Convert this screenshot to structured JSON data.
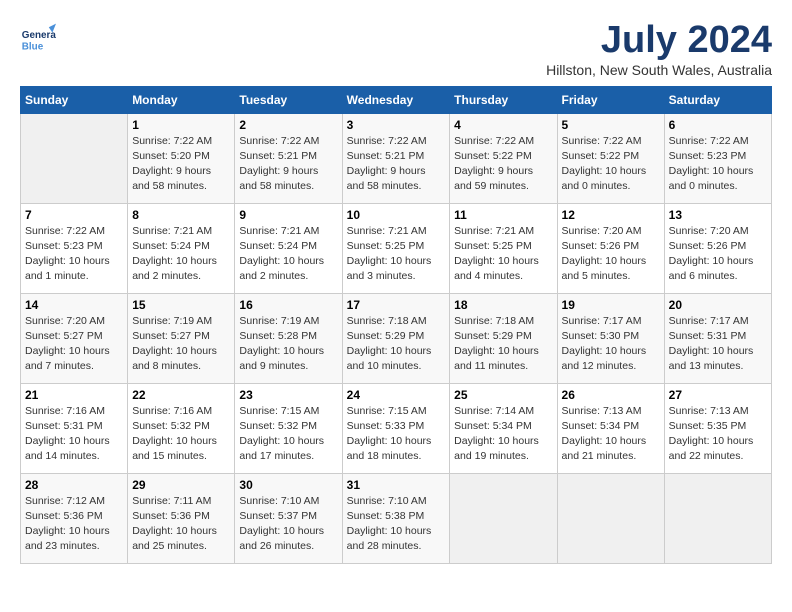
{
  "header": {
    "logo_general": "General",
    "logo_blue": "Blue",
    "month_title": "July 2024",
    "location": "Hillston, New South Wales, Australia"
  },
  "days_of_week": [
    "Sunday",
    "Monday",
    "Tuesday",
    "Wednesday",
    "Thursday",
    "Friday",
    "Saturday"
  ],
  "weeks": [
    [
      {
        "day": "",
        "info": ""
      },
      {
        "day": "1",
        "info": "Sunrise: 7:22 AM\nSunset: 5:20 PM\nDaylight: 9 hours\nand 58 minutes."
      },
      {
        "day": "2",
        "info": "Sunrise: 7:22 AM\nSunset: 5:21 PM\nDaylight: 9 hours\nand 58 minutes."
      },
      {
        "day": "3",
        "info": "Sunrise: 7:22 AM\nSunset: 5:21 PM\nDaylight: 9 hours\nand 58 minutes."
      },
      {
        "day": "4",
        "info": "Sunrise: 7:22 AM\nSunset: 5:22 PM\nDaylight: 9 hours\nand 59 minutes."
      },
      {
        "day": "5",
        "info": "Sunrise: 7:22 AM\nSunset: 5:22 PM\nDaylight: 10 hours\nand 0 minutes."
      },
      {
        "day": "6",
        "info": "Sunrise: 7:22 AM\nSunset: 5:23 PM\nDaylight: 10 hours\nand 0 minutes."
      }
    ],
    [
      {
        "day": "7",
        "info": "Sunrise: 7:22 AM\nSunset: 5:23 PM\nDaylight: 10 hours\nand 1 minute."
      },
      {
        "day": "8",
        "info": "Sunrise: 7:21 AM\nSunset: 5:24 PM\nDaylight: 10 hours\nand 2 minutes."
      },
      {
        "day": "9",
        "info": "Sunrise: 7:21 AM\nSunset: 5:24 PM\nDaylight: 10 hours\nand 2 minutes."
      },
      {
        "day": "10",
        "info": "Sunrise: 7:21 AM\nSunset: 5:25 PM\nDaylight: 10 hours\nand 3 minutes."
      },
      {
        "day": "11",
        "info": "Sunrise: 7:21 AM\nSunset: 5:25 PM\nDaylight: 10 hours\nand 4 minutes."
      },
      {
        "day": "12",
        "info": "Sunrise: 7:20 AM\nSunset: 5:26 PM\nDaylight: 10 hours\nand 5 minutes."
      },
      {
        "day": "13",
        "info": "Sunrise: 7:20 AM\nSunset: 5:26 PM\nDaylight: 10 hours\nand 6 minutes."
      }
    ],
    [
      {
        "day": "14",
        "info": "Sunrise: 7:20 AM\nSunset: 5:27 PM\nDaylight: 10 hours\nand 7 minutes."
      },
      {
        "day": "15",
        "info": "Sunrise: 7:19 AM\nSunset: 5:27 PM\nDaylight: 10 hours\nand 8 minutes."
      },
      {
        "day": "16",
        "info": "Sunrise: 7:19 AM\nSunset: 5:28 PM\nDaylight: 10 hours\nand 9 minutes."
      },
      {
        "day": "17",
        "info": "Sunrise: 7:18 AM\nSunset: 5:29 PM\nDaylight: 10 hours\nand 10 minutes."
      },
      {
        "day": "18",
        "info": "Sunrise: 7:18 AM\nSunset: 5:29 PM\nDaylight: 10 hours\nand 11 minutes."
      },
      {
        "day": "19",
        "info": "Sunrise: 7:17 AM\nSunset: 5:30 PM\nDaylight: 10 hours\nand 12 minutes."
      },
      {
        "day": "20",
        "info": "Sunrise: 7:17 AM\nSunset: 5:31 PM\nDaylight: 10 hours\nand 13 minutes."
      }
    ],
    [
      {
        "day": "21",
        "info": "Sunrise: 7:16 AM\nSunset: 5:31 PM\nDaylight: 10 hours\nand 14 minutes."
      },
      {
        "day": "22",
        "info": "Sunrise: 7:16 AM\nSunset: 5:32 PM\nDaylight: 10 hours\nand 15 minutes."
      },
      {
        "day": "23",
        "info": "Sunrise: 7:15 AM\nSunset: 5:32 PM\nDaylight: 10 hours\nand 17 minutes."
      },
      {
        "day": "24",
        "info": "Sunrise: 7:15 AM\nSunset: 5:33 PM\nDaylight: 10 hours\nand 18 minutes."
      },
      {
        "day": "25",
        "info": "Sunrise: 7:14 AM\nSunset: 5:34 PM\nDaylight: 10 hours\nand 19 minutes."
      },
      {
        "day": "26",
        "info": "Sunrise: 7:13 AM\nSunset: 5:34 PM\nDaylight: 10 hours\nand 21 minutes."
      },
      {
        "day": "27",
        "info": "Sunrise: 7:13 AM\nSunset: 5:35 PM\nDaylight: 10 hours\nand 22 minutes."
      }
    ],
    [
      {
        "day": "28",
        "info": "Sunrise: 7:12 AM\nSunset: 5:36 PM\nDaylight: 10 hours\nand 23 minutes."
      },
      {
        "day": "29",
        "info": "Sunrise: 7:11 AM\nSunset: 5:36 PM\nDaylight: 10 hours\nand 25 minutes."
      },
      {
        "day": "30",
        "info": "Sunrise: 7:10 AM\nSunset: 5:37 PM\nDaylight: 10 hours\nand 26 minutes."
      },
      {
        "day": "31",
        "info": "Sunrise: 7:10 AM\nSunset: 5:38 PM\nDaylight: 10 hours\nand 28 minutes."
      },
      {
        "day": "",
        "info": ""
      },
      {
        "day": "",
        "info": ""
      },
      {
        "day": "",
        "info": ""
      }
    ]
  ]
}
